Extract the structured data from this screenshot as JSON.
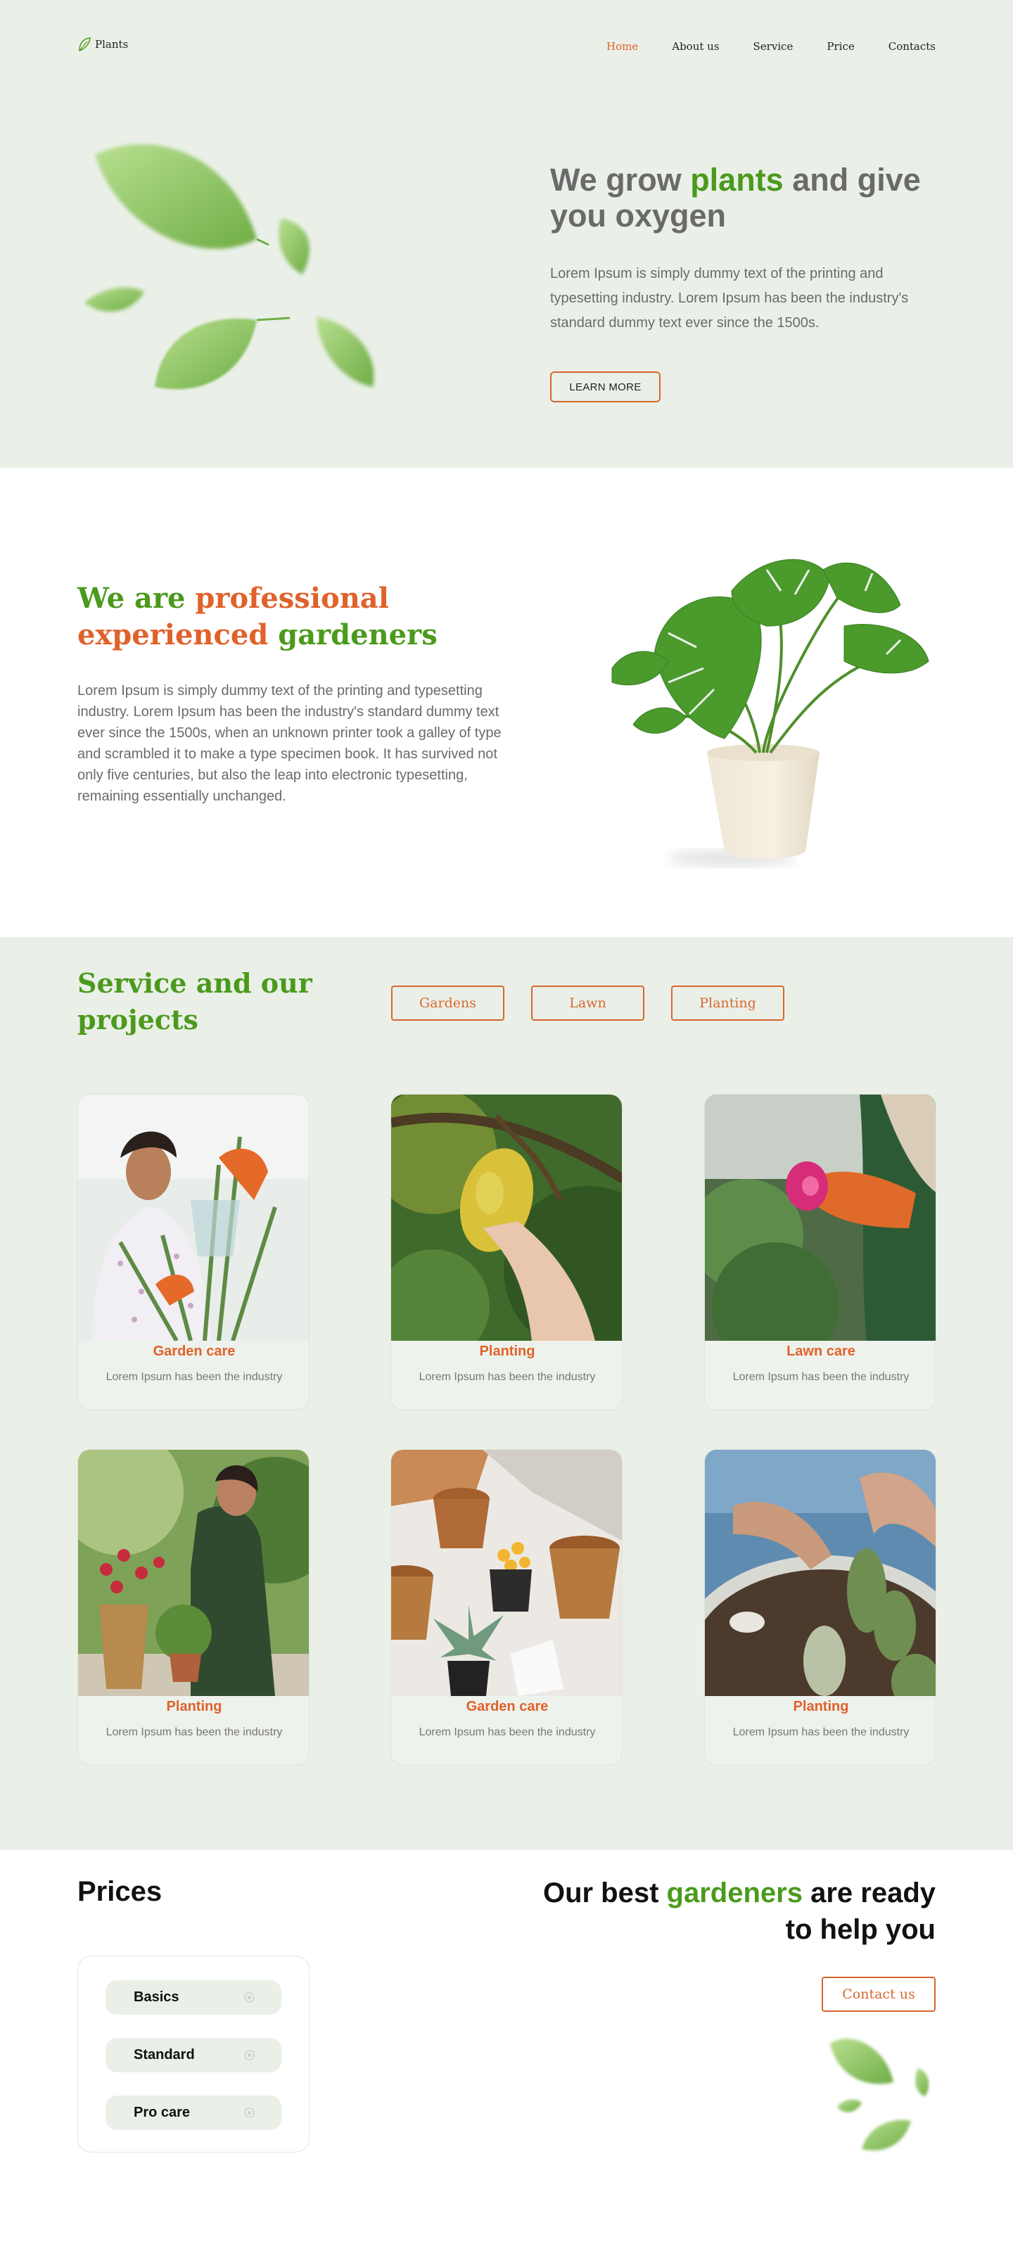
{
  "header": {
    "logo_text": "Plants",
    "nav": [
      {
        "label": "Home",
        "active": true
      },
      {
        "label": "About us",
        "active": false
      },
      {
        "label": "Service",
        "active": false
      },
      {
        "label": "Price",
        "active": false
      },
      {
        "label": "Contacts",
        "active": false
      }
    ]
  },
  "hero": {
    "title_part1": "We grow ",
    "title_highlight": "plants",
    "title_part2": " and give you oxygen",
    "text": "Lorem Ipsum is simply dummy text of the printing and typesetting industry. Lorem Ipsum has been the industry's standard dummy text ever since the 1500s.",
    "button_label": "LEARN MORE"
  },
  "about": {
    "title_part1": "We are ",
    "title_highlight": "professional experienced",
    "title_part2": " gardeners",
    "text": "Lorem Ipsum is simply dummy text of the printing and typesetting industry. Lorem Ipsum has been the industry's standard dummy text ever since the 1500s, when an unknown printer took a galley of type and scrambled it to make a type specimen book. It has survived not only five centuries, but also the leap into electronic typesetting, remaining essentially unchanged."
  },
  "services": {
    "title": "Service and our projects",
    "filters": [
      "Gardens",
      "Lawn",
      "Planting"
    ],
    "cards": [
      {
        "title": "Garden care",
        "subtitle": "Lorem Ipsum has been the industry"
      },
      {
        "title": "Planting",
        "subtitle": "Lorem Ipsum has been the industry"
      },
      {
        "title": "Lawn care",
        "subtitle": "Lorem Ipsum has been the industry"
      },
      {
        "title": "Planting",
        "subtitle": "Lorem Ipsum has been the industry"
      },
      {
        "title": "Garden care",
        "subtitle": "Lorem Ipsum has been the industry"
      },
      {
        "title": "Planting",
        "subtitle": "Lorem Ipsum has been the industry"
      }
    ]
  },
  "prices": {
    "title": "Prices",
    "plans": [
      "Basics",
      "Standard",
      "Pro care"
    ]
  },
  "cta": {
    "title_part1": "Our best ",
    "title_highlight": "gardeners",
    "title_part2": " are ready to help you",
    "button_label": "Contact us"
  },
  "colors": {
    "accent_green": "#4b9a1c",
    "accent_orange": "#e0622b",
    "section_bg": "#eaf0e8"
  },
  "icons": [
    "leaf-logo-icon",
    "radio-dot-icon"
  ]
}
